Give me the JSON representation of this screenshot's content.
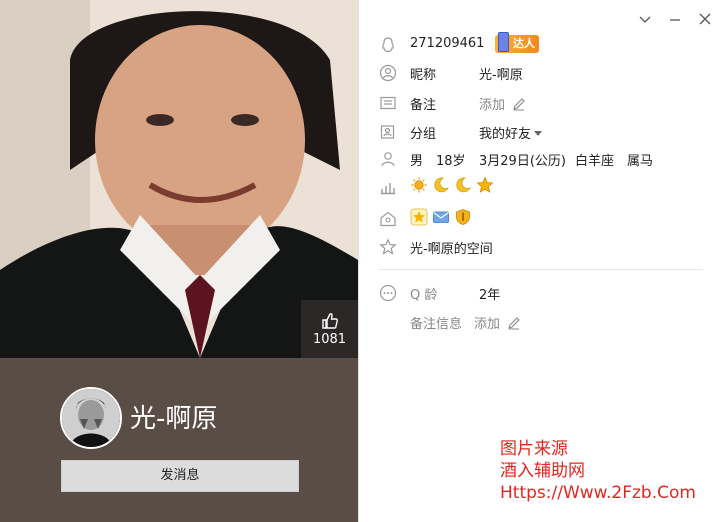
{
  "profile": {
    "qq_number": "271209461",
    "daren_badge": "达人",
    "nickname_label": "昵称",
    "nickname_value": "光-啊原",
    "remark_label": "备注",
    "remark_add": "添加",
    "group_label": "分组",
    "group_value": "我的好友",
    "gender": "男",
    "age": "18岁",
    "birthday": "3月29日(公历)",
    "constellation": "白羊座",
    "zodiac": "属马",
    "space_text": "光-啊原的空间",
    "qage_label": "Q 龄",
    "qage_value": "2年",
    "remark_info_label": "备注信息",
    "remark_info_add": "添加"
  },
  "left": {
    "like_count": "1081",
    "display_name": "光-啊原",
    "send_message_label": "发消息"
  },
  "watermark": {
    "line1": "图片来源",
    "line2": "酒入辅助网",
    "line3": "Https://Www.2Fzb.Com"
  },
  "colors": {
    "left_panel_bg": "#5a4d46",
    "watermark": "#e3261f",
    "level_sun": "#f5b21a",
    "level_moon": "#f2c12e",
    "level_star": "#f4b400"
  },
  "icons": {
    "window": [
      "chevron-down-icon",
      "minimize-icon",
      "close-icon"
    ],
    "rows": [
      "qq-penguin-icon",
      "person-circle-icon",
      "card-icon",
      "group-icon",
      "person-icon",
      "level-chart-icon",
      "home-icon",
      "star-outline-icon",
      "more-icon"
    ],
    "levels": [
      "sun-icon",
      "moon-icon",
      "moon-icon",
      "star-icon"
    ],
    "privileges": [
      "yellow-star-icon",
      "mail-icon",
      "shield-icon"
    ]
  }
}
